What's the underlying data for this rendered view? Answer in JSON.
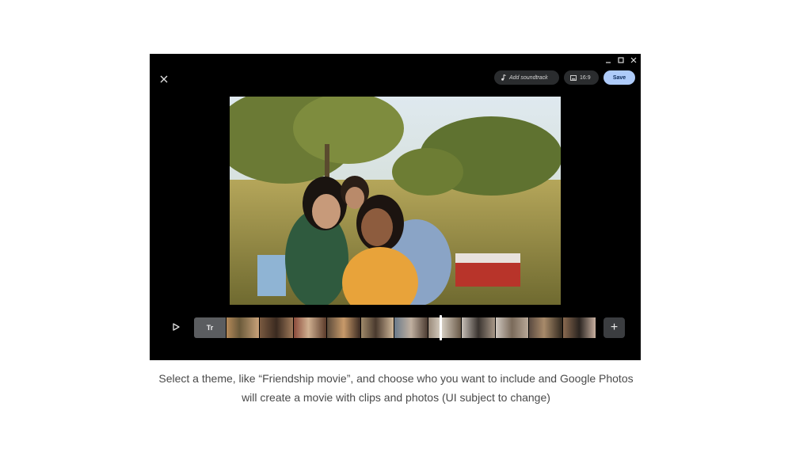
{
  "window": {
    "controls": [
      "minimize-icon",
      "maximize-icon",
      "close-icon"
    ],
    "close_icon": "close-icon"
  },
  "toolbar": {
    "soundtrack_label": "Add soundtrack",
    "soundtrack_icon": "music-note-icon",
    "aspect_label": "16:9",
    "aspect_icon": "image-icon",
    "save_label": "Save"
  },
  "timeline": {
    "play_icon": "play-icon",
    "text_clip_label": "Tr",
    "add_label": "+",
    "thumbnails": 11,
    "playhead_position": 0.72
  },
  "caption": {
    "line1": "Select a theme, like “Friendship movie”, and choose who you want to include and Google Photos",
    "line2": "will create a movie with clips and photos (UI subject to change)"
  },
  "colors": {
    "window_bg": "#000000",
    "save_bg": "#aecbfa",
    "pill_bg": "#2a2c2e"
  }
}
